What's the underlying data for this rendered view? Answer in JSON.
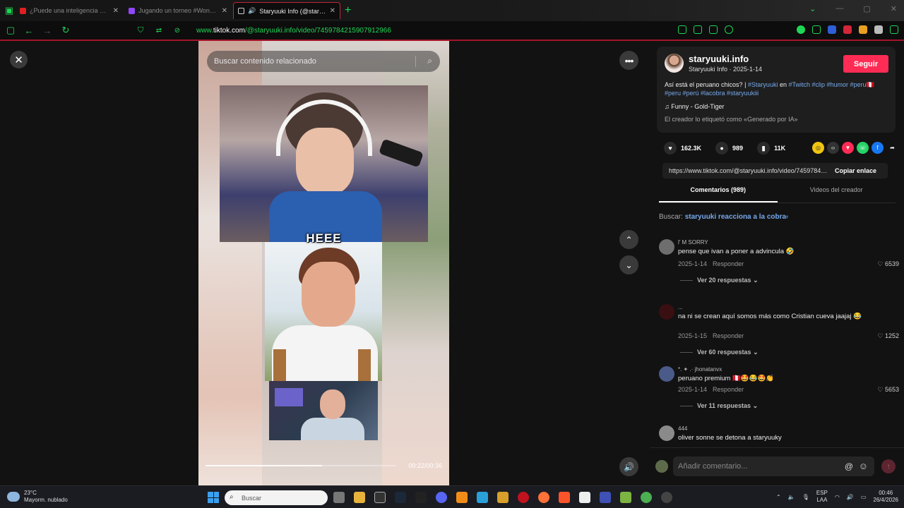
{
  "browser": {
    "tabs": [
      {
        "title": "¿Puede una inteligencia artificial",
        "color": "#e02020",
        "active": false
      },
      {
        "title": "Jugando un torneo #Wondercu",
        "color": "#9146ff",
        "active": false
      },
      {
        "title": "Staryuuki Info (@staryuuki.",
        "color": "#111111",
        "active": true
      }
    ],
    "url_prefix": "www.",
    "url_host": "tiktok.com",
    "url_path": "/@staryuuki.info/video/7459784215907912966"
  },
  "video": {
    "search_placeholder": "Buscar contenido relacionado",
    "overlay_text": "HEEE",
    "time": "00:22/00:36",
    "progress_fraction": 0.61
  },
  "creator": {
    "handle": "staryuuki.info",
    "subtitle": "Staryuuki Info · 2025-1-14",
    "follow_label": "Seguir",
    "caption_plain": "Así está el peruano chicos?",
    "caption_sep": " | ",
    "caption_tag1": "#Staryuuki",
    "caption_en": " en ",
    "caption_tags": "#Twitch #clip #humor #peru",
    "caption_tags2": " #peru #perú #lacobra #staryuukiii",
    "music": "Funny - Gold-Tiger",
    "ai_label": "El creador lo etiquetó como «Generado por IA»"
  },
  "stats": {
    "likes": "162.3K",
    "comments": "989",
    "saves": "11K"
  },
  "link": {
    "url": "https://www.tiktok.com/@staryuuki.info/video/7459784215907912966",
    "copy_label": "Copiar enlace"
  },
  "panel_tabs": {
    "comments": "Comentarios (989)",
    "creator_videos": "Videos del creador"
  },
  "search": {
    "label": "Buscar: ",
    "query": "staryuuki reacciona a la cobra"
  },
  "comments": [
    {
      "user": "l' M SORRY",
      "text": "pense que ivan a poner a advincula 🤣",
      "date": "2025-1-14",
      "reply": "Responder",
      "likes": "6539",
      "more": "Ver 20 respuestas",
      "avatar_color": "#6e6e6e"
    },
    {
      "user": "...",
      "text": "na ni se crean aquí somos más como Cristian cueva jaajaj 😂",
      "date": "2025-1-15",
      "reply": "Responder",
      "likes": "1252",
      "more": "Ver 60 respuestas",
      "avatar_color": "#3a0f12"
    },
    {
      "user": "*. ✦ .· jhonatanvx",
      "text": "peruano premium 🇵🇪🤩😂🤩👏",
      "date": "2025-1-14",
      "reply": "Responder",
      "likes": "5653",
      "more": "Ver 11 respuestas",
      "avatar_color": "#4a5b8a"
    },
    {
      "user": "444",
      "text": "oliver sonne se detona a staryuuky",
      "date": "",
      "reply": "",
      "likes": "",
      "more": "",
      "avatar_color": "#8a8a8a"
    }
  ],
  "composer": {
    "placeholder": "Añadir comentario..."
  },
  "taskbar": {
    "temp": "23°C",
    "weather": "Mayorm. nublado",
    "search_placeholder": "Buscar",
    "lang1": "ESP",
    "lang2": "LAA",
    "time": "00:46",
    "date": "26/4/2026"
  }
}
